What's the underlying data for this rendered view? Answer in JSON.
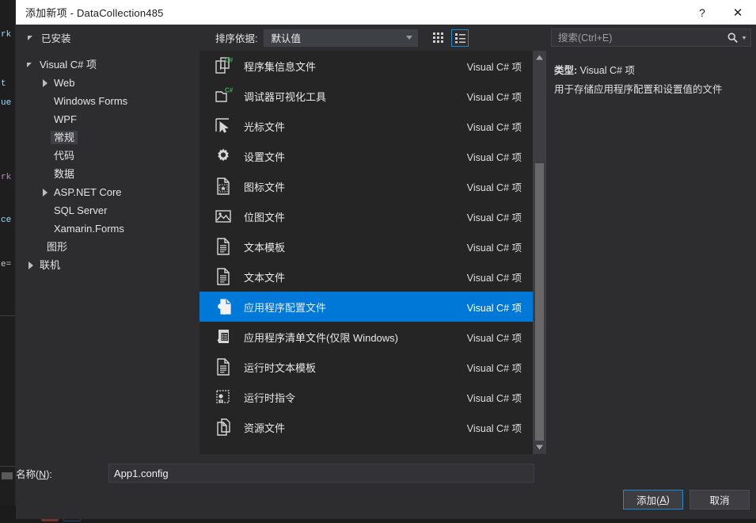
{
  "window": {
    "title": "添加新项 - DataCollection485",
    "help_label": "?",
    "close_label": "✕"
  },
  "toolbar": {
    "installed_label": "已安装",
    "sort_label": "排序依据:",
    "sort_value": "默认值",
    "view_tiles_name": "tiles-view",
    "view_list_name": "list-view"
  },
  "search": {
    "placeholder": "搜索(Ctrl+E)",
    "value": ""
  },
  "tree": [
    {
      "label": "Visual C# 项",
      "indent": 0,
      "state": "expanded",
      "selected": false
    },
    {
      "label": "Web",
      "indent": 1,
      "state": "collapsed",
      "selected": false
    },
    {
      "label": "Windows Forms",
      "indent": 1,
      "state": "leaf",
      "selected": false
    },
    {
      "label": "WPF",
      "indent": 1,
      "state": "leaf",
      "selected": false
    },
    {
      "label": "常规",
      "indent": 1,
      "state": "leaf",
      "selected": true
    },
    {
      "label": "代码",
      "indent": 1,
      "state": "leaf",
      "selected": false
    },
    {
      "label": "数据",
      "indent": 1,
      "state": "leaf",
      "selected": false
    },
    {
      "label": "ASP.NET Core",
      "indent": 1,
      "state": "collapsed",
      "selected": false
    },
    {
      "label": "SQL Server",
      "indent": 1,
      "state": "leaf",
      "selected": false
    },
    {
      "label": "Xamarin.Forms",
      "indent": 1,
      "state": "leaf",
      "selected": false
    },
    {
      "label": "图形",
      "indent": 0.5,
      "state": "leaf",
      "selected": false
    },
    {
      "label": "联机",
      "indent": 0,
      "state": "collapsed",
      "selected": false
    }
  ],
  "items": [
    {
      "name": "程序集信息文件",
      "type": "Visual C# 项",
      "icon": "assembly-info-file-icon",
      "selected": false
    },
    {
      "name": "调试器可视化工具",
      "type": "Visual C# 项",
      "icon": "debugger-visualizer-icon",
      "selected": false
    },
    {
      "name": "光标文件",
      "type": "Visual C# 项",
      "icon": "cursor-file-icon",
      "selected": false
    },
    {
      "name": "设置文件",
      "type": "Visual C# 项",
      "icon": "settings-file-icon",
      "selected": false
    },
    {
      "name": "图标文件",
      "type": "Visual C# 项",
      "icon": "icon-file-icon",
      "selected": false
    },
    {
      "name": "位图文件",
      "type": "Visual C# 项",
      "icon": "bitmap-file-icon",
      "selected": false
    },
    {
      "name": "文本模板",
      "type": "Visual C# 项",
      "icon": "text-template-icon",
      "selected": false
    },
    {
      "name": "文本文件",
      "type": "Visual C# 项",
      "icon": "text-file-icon",
      "selected": false
    },
    {
      "name": "应用程序配置文件",
      "type": "Visual C# 项",
      "icon": "app-config-file-icon",
      "selected": true
    },
    {
      "name": "应用程序清单文件(仅限 Windows)",
      "type": "Visual C# 项",
      "icon": "app-manifest-file-icon",
      "selected": false
    },
    {
      "name": "运行时文本模板",
      "type": "Visual C# 项",
      "icon": "runtime-text-template-icon",
      "selected": false
    },
    {
      "name": "运行时指令",
      "type": "Visual C# 项",
      "icon": "runtime-directive-icon",
      "selected": false
    },
    {
      "name": "资源文件",
      "type": "Visual C# 项",
      "icon": "resource-file-icon",
      "selected": false
    }
  ],
  "detail": {
    "type_key": "类型:",
    "type_value": "Visual C# 项",
    "description": "用于存储应用程序配置和设置值的文件"
  },
  "name_field": {
    "label_pre": "名称(",
    "label_key": "N",
    "label_post": "):",
    "value": "App1.config"
  },
  "buttons": {
    "add_pre": "添加(",
    "add_key": "A",
    "add_post": ")",
    "cancel": "取消"
  },
  "colors": {
    "accent": "#0078d7",
    "focus_border": "#1b8ad4",
    "dialog_bg": "#2d2d30",
    "list_bg": "#252526",
    "titlebar_bg": "#ffffff"
  },
  "background_code": [
    "rk",
    "t",
    "ue",
    "rk",
    "ce",
    "e="
  ]
}
